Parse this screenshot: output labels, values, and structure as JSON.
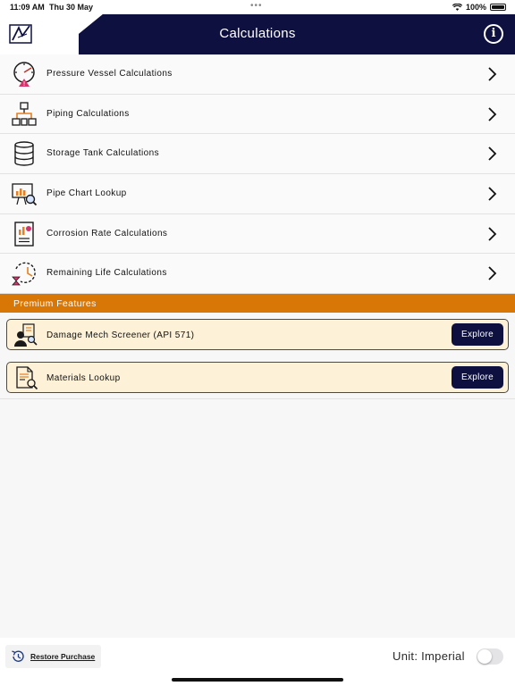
{
  "status_bar": {
    "time": "11:09 AM",
    "date": "Thu 30 May",
    "battery_text": "100%",
    "icons": [
      "wifi-icon",
      "battery-icon"
    ]
  },
  "header": {
    "title": "Calculations",
    "logo_icon": "app-logo-icon",
    "info_icon": "info-icon",
    "info_glyph": "i",
    "colors": {
      "background": "#0e1140",
      "text": "#ffffff"
    }
  },
  "calculations": [
    {
      "label": "Pressure Vessel Calculations",
      "icon": "gauge-warning-icon"
    },
    {
      "label": "Piping Calculations",
      "icon": "piping-network-icon"
    },
    {
      "label": "Storage Tank Calculations",
      "icon": "database-tank-icon"
    },
    {
      "label": "Pipe Chart Lookup",
      "icon": "chart-search-icon"
    },
    {
      "label": "Corrosion Rate Calculations",
      "icon": "report-chart-icon"
    },
    {
      "label": "Remaining Life Calculations",
      "icon": "hourglass-cycle-icon"
    }
  ],
  "premium": {
    "section_title": "Premium Features",
    "accent_color": "#d97706",
    "card_color": "#fdf1d8",
    "items": [
      {
        "title": "Damage Mech Screener (API 571)",
        "button": "Explore",
        "icon": "inspector-icon"
      },
      {
        "title": "Materials Lookup",
        "button": "Explore",
        "icon": "document-search-icon"
      }
    ]
  },
  "footer": {
    "restore_label": "Restore Purchase",
    "restore_icon": "history-icon",
    "unit_label": "Unit: Imperial",
    "unit_toggle_on": false
  }
}
